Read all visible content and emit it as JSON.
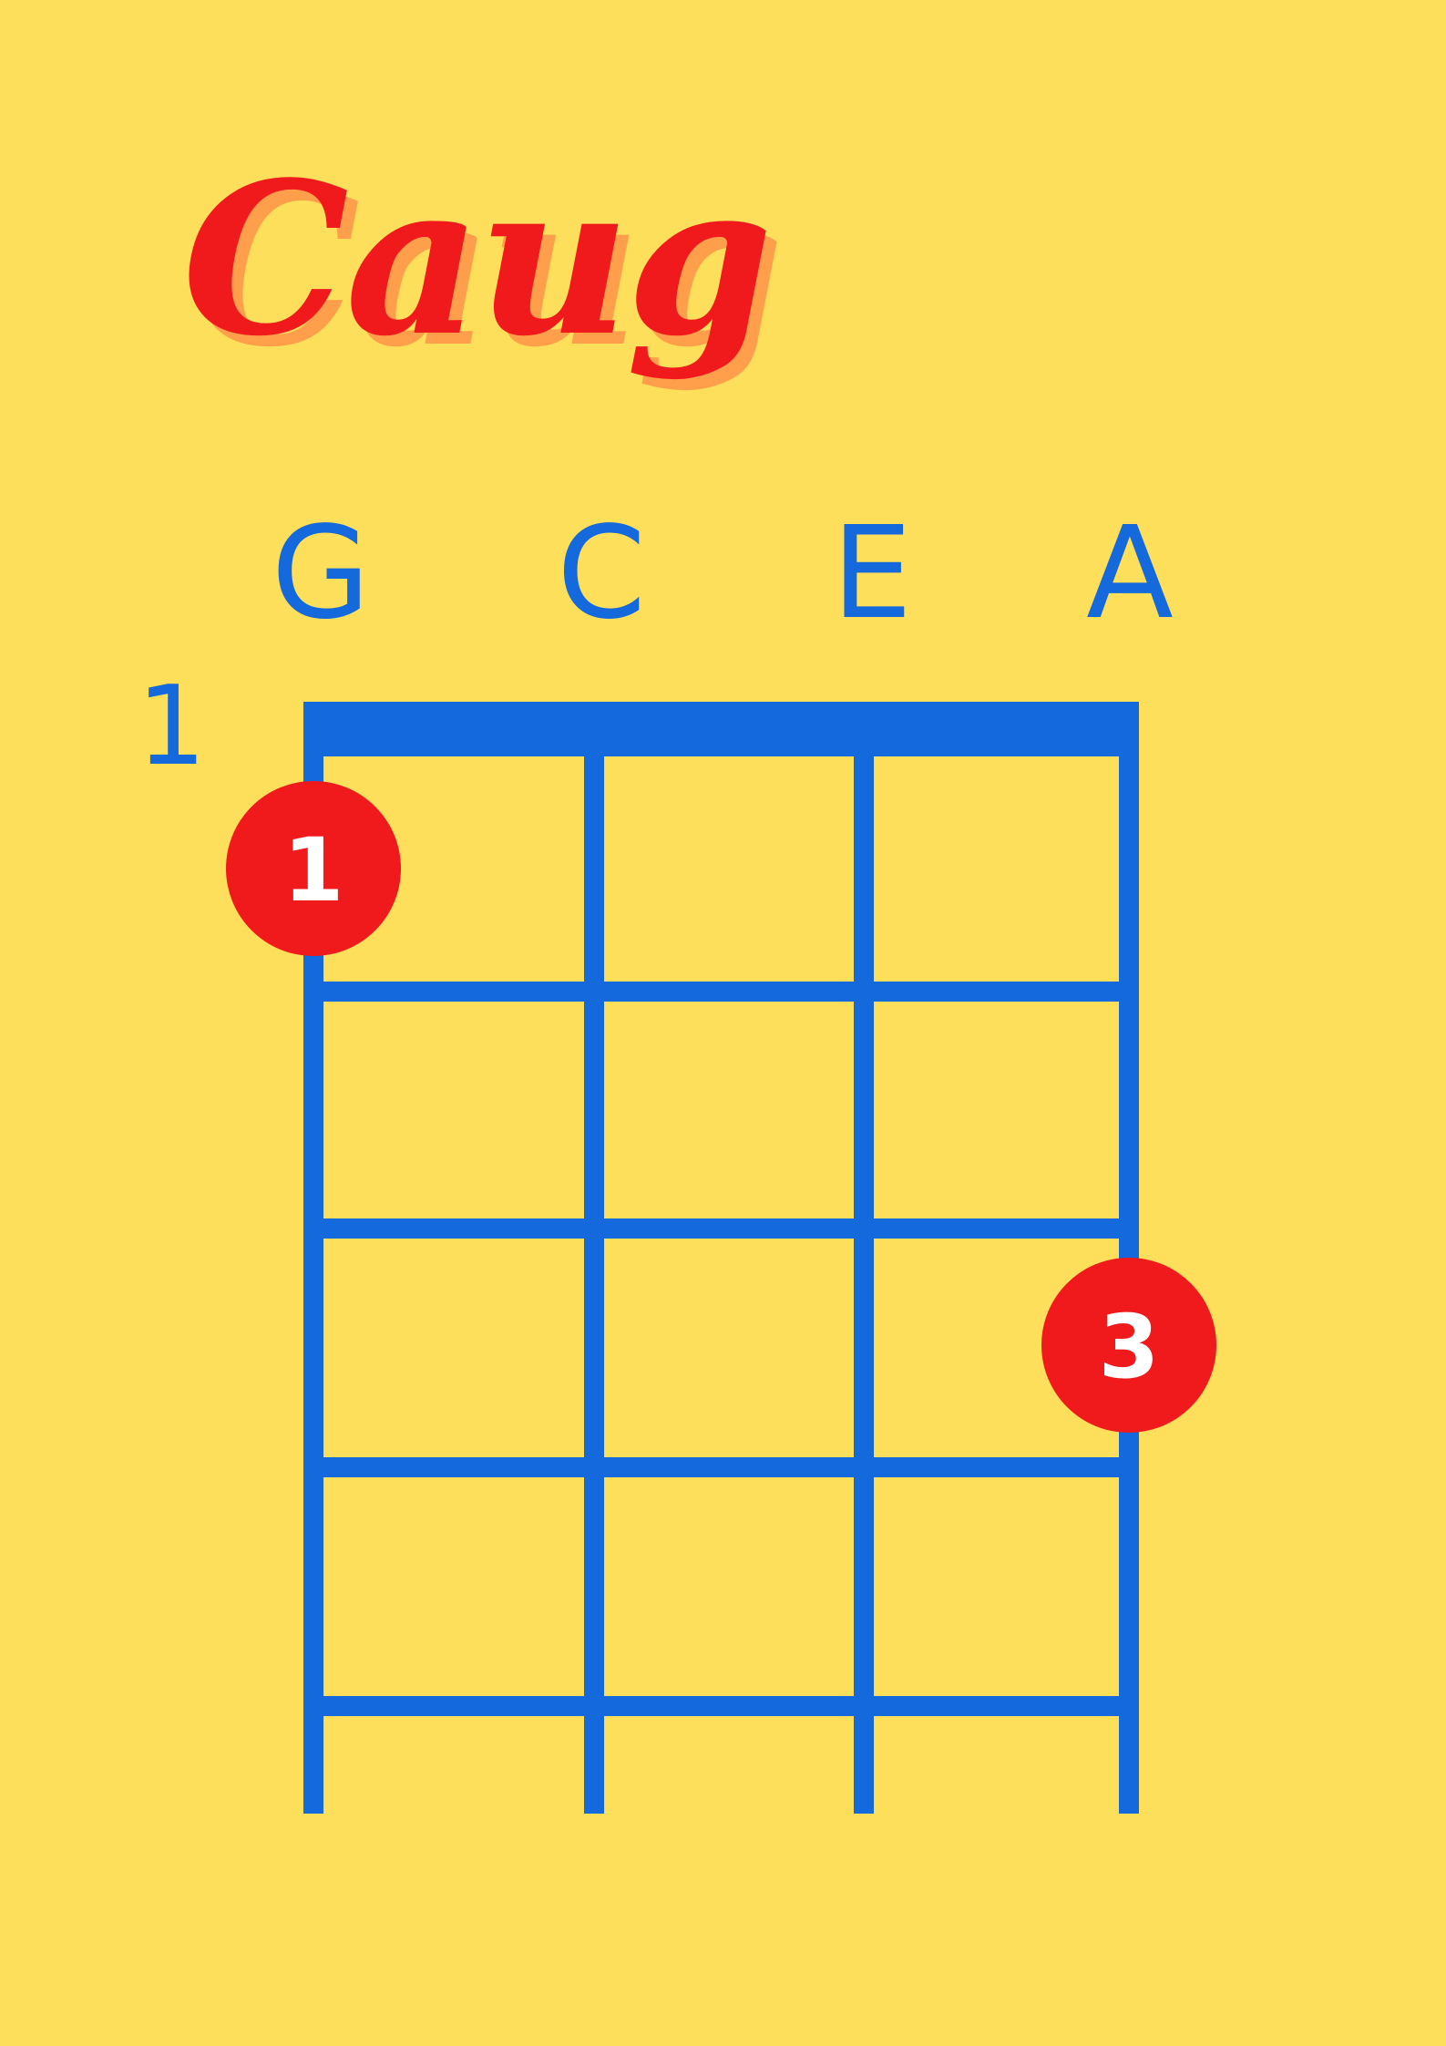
{
  "chord": {
    "name": "Caug"
  },
  "strings": [
    "G",
    "C",
    "E",
    "A"
  ],
  "start_fret": "1",
  "frets_shown": 5,
  "fingers": [
    {
      "string_index": 0,
      "fret": 1,
      "finger": "1"
    },
    {
      "string_index": 3,
      "fret": 3,
      "finger": "3"
    }
  ],
  "colors": {
    "background": "#FEDF5B",
    "grid": "#1469DC",
    "title": "#F01A1D",
    "title_shadow": "#FF9E4B",
    "dot": "#F01A1D",
    "dot_text": "#FFFFFF"
  }
}
